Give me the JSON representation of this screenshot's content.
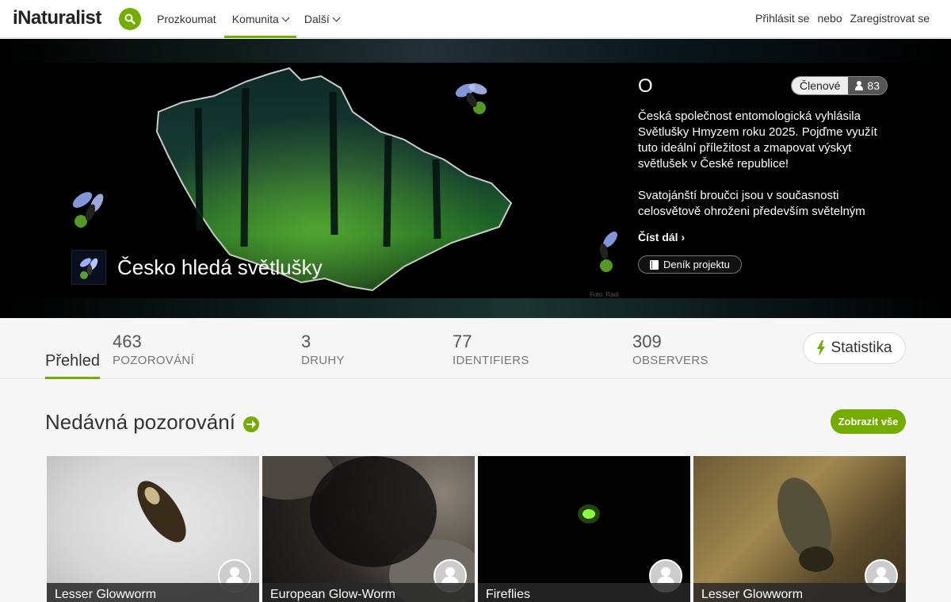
{
  "header": {
    "logo": "iNaturalist",
    "nav": [
      {
        "label": "Prozkoumat",
        "dropdown": false,
        "active": false
      },
      {
        "label": "Komunita",
        "dropdown": true,
        "active": true
      },
      {
        "label": "Další",
        "dropdown": true,
        "active": false
      }
    ],
    "login": "Přihlásit se",
    "or": "nebo",
    "signup": "Zaregistrovat se"
  },
  "hero": {
    "project_title": "Česko hledá světlušky",
    "heading": "O",
    "members_label": "Členové",
    "members_count": "83",
    "description": [
      "Česká společnost entomologická vyhlásila Světlušky Hmyzem roku 2025. Pojďme využít tuto ideální příležitost a zmapovat výskyt světlušek v České republice!",
      "Svatojánští broučci jsou v současnosti celosvětově ohroženi především světelným"
    ],
    "read_more": "Číst dál",
    "journal": "Deník projektu",
    "photo_credit": "Foto: Radi"
  },
  "stats": {
    "overview_tab": "Přehled",
    "items": [
      {
        "num": "463",
        "label": "POZOROVÁNÍ"
      },
      {
        "num": "3",
        "label": "DRUHY"
      },
      {
        "num": "77",
        "label": "IDENTIFIERS"
      },
      {
        "num": "309",
        "label": "OBSERVERS"
      }
    ],
    "stats_button": "Statistika"
  },
  "recent": {
    "title": "Nedávná pozorování",
    "view_all": "Zobrazit vše",
    "cards": [
      {
        "name": "Lesser Glowworm"
      },
      {
        "name": "European Glow-Worm"
      },
      {
        "name": "Fireflies"
      },
      {
        "name": "Lesser Glowworm"
      }
    ]
  },
  "colors": {
    "accent": "#74ac00",
    "hero_bg": "#000000"
  }
}
